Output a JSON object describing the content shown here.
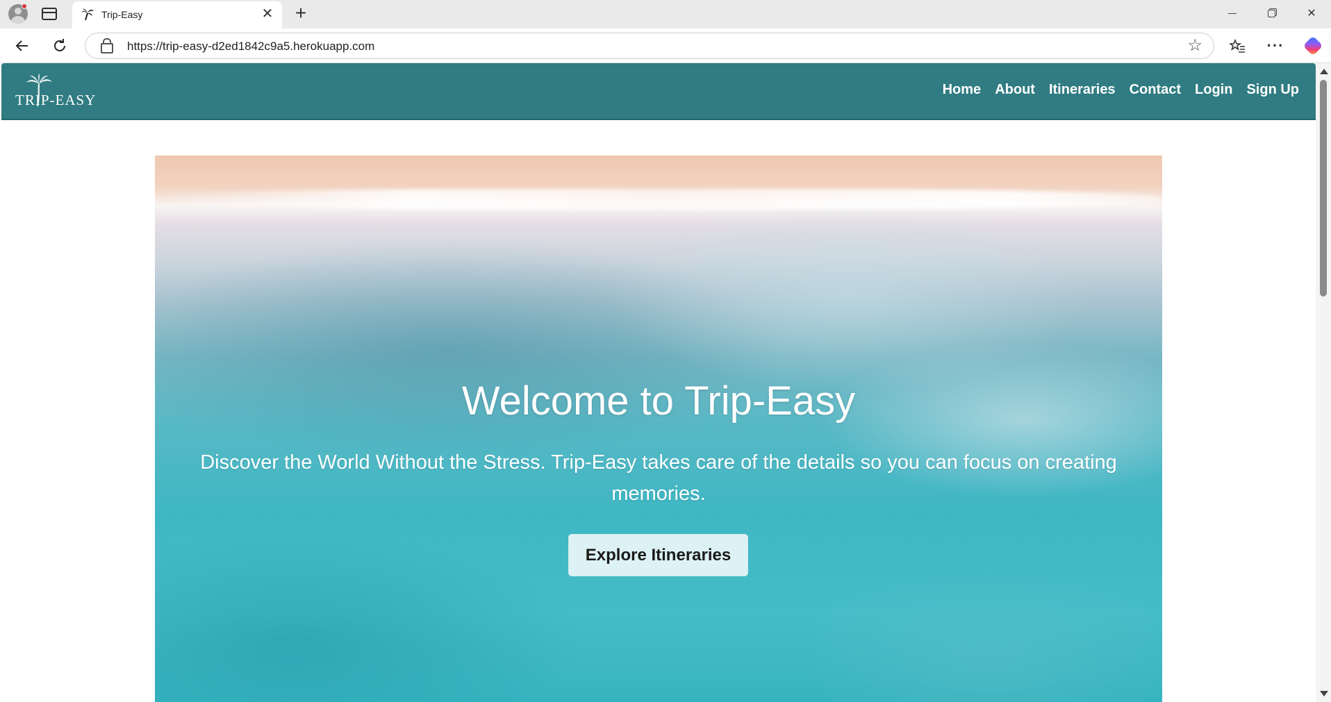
{
  "browser": {
    "tab_title": "Trip-Easy",
    "url": "https://trip-easy-d2ed1842c9a5.herokuapp.com",
    "new_tab_symbol": "+",
    "close_tab_symbol": "✕"
  },
  "site": {
    "logo_text": "TRIP-EASY",
    "logo_icon": "palm-tree-icon",
    "nav": [
      {
        "label": "Home"
      },
      {
        "label": "About"
      },
      {
        "label": "Itineraries"
      },
      {
        "label": "Contact"
      },
      {
        "label": "Login"
      },
      {
        "label": "Sign Up"
      }
    ]
  },
  "hero": {
    "title": "Welcome to Trip-Easy",
    "subtitle": "Discover the World Without the Stress. Trip-Easy takes care of the details so you can focus on creating memories.",
    "cta_label": "Explore Itineraries",
    "background": "aerial-beach-turquoise-sea"
  },
  "colors": {
    "navbar": "#307c82",
    "nav_text": "#ffffff",
    "hero_sand": "#efc8b2",
    "hero_sea": "#3eb7c4"
  }
}
